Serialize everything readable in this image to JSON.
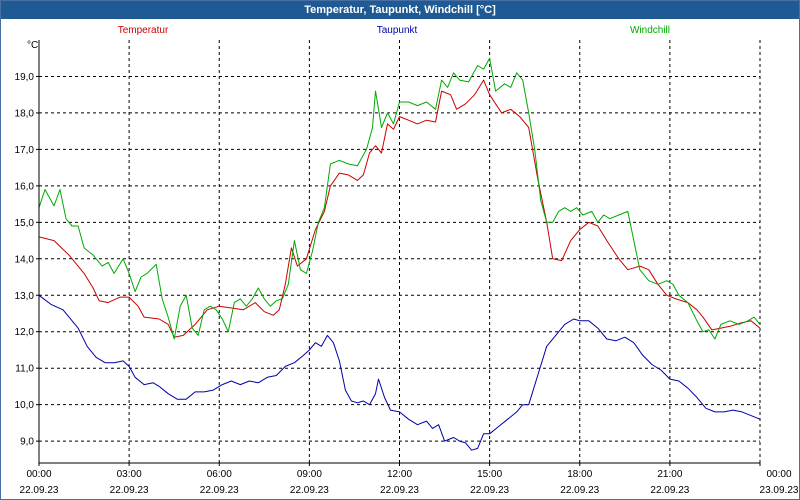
{
  "window": {
    "title": "Temperatur, Taupunkt, Windchill [°C]"
  },
  "chart_data": {
    "type": "line",
    "title": "Temperatur, Taupunkt, Windchill [°C]",
    "ylabel": "°C",
    "xlabel": "",
    "ylim": [
      8.4,
      20.0
    ],
    "xlim": [
      0,
      24
    ],
    "grid": true,
    "legend_position": "top",
    "x_ticks": [
      {
        "x": 0,
        "time": "00:00",
        "date": "22.09.23"
      },
      {
        "x": 3,
        "time": "03:00",
        "date": "22.09.23"
      },
      {
        "x": 6,
        "time": "06:00",
        "date": "22.09.23"
      },
      {
        "x": 9,
        "time": "09:00",
        "date": "22.09.23"
      },
      {
        "x": 12,
        "time": "12:00",
        "date": "22.09.23"
      },
      {
        "x": 15,
        "time": "15:00",
        "date": "22.09.23"
      },
      {
        "x": 18,
        "time": "18:00",
        "date": "22.09.23"
      },
      {
        "x": 21,
        "time": "21:00",
        "date": "22.09.23"
      },
      {
        "x": 24,
        "time": "00:00",
        "date": "23.09.23"
      }
    ],
    "y_ticks": [
      9.0,
      10.0,
      11.0,
      12.0,
      13.0,
      14.0,
      15.0,
      16.0,
      17.0,
      18.0,
      19.0
    ],
    "y_tick_labels": [
      "9,0",
      "10,0",
      "11,0",
      "12,0",
      "13,0",
      "14,0",
      "15,0",
      "16,0",
      "17,0",
      "18,0",
      "19,0"
    ],
    "series": [
      {
        "name": "Temperatur",
        "color": "#cc0000",
        "points": [
          [
            0,
            14.6
          ],
          [
            0.5,
            14.5
          ],
          [
            1,
            14.1
          ],
          [
            1.5,
            13.6
          ],
          [
            1.8,
            13.2
          ],
          [
            2,
            12.85
          ],
          [
            2.3,
            12.8
          ],
          [
            2.7,
            12.95
          ],
          [
            3,
            12.95
          ],
          [
            3.3,
            12.7
          ],
          [
            3.5,
            12.4
          ],
          [
            4,
            12.35
          ],
          [
            4.3,
            12.2
          ],
          [
            4.5,
            11.85
          ],
          [
            4.8,
            11.9
          ],
          [
            5.2,
            12.2
          ],
          [
            5.6,
            12.6
          ],
          [
            6,
            12.7
          ],
          [
            6.4,
            12.65
          ],
          [
            6.8,
            12.6
          ],
          [
            7.2,
            12.8
          ],
          [
            7.5,
            12.55
          ],
          [
            7.8,
            12.45
          ],
          [
            8,
            12.6
          ],
          [
            8.2,
            13.3
          ],
          [
            8.4,
            14.3
          ],
          [
            8.6,
            13.8
          ],
          [
            8.9,
            14.0
          ],
          [
            9.2,
            14.8
          ],
          [
            9.5,
            15.3
          ],
          [
            9.7,
            16.0
          ],
          [
            10,
            16.35
          ],
          [
            10.3,
            16.3
          ],
          [
            10.6,
            16.15
          ],
          [
            10.8,
            16.3
          ],
          [
            11,
            16.9
          ],
          [
            11.2,
            17.1
          ],
          [
            11.4,
            16.9
          ],
          [
            11.6,
            17.7
          ],
          [
            11.8,
            17.55
          ],
          [
            12,
            17.9
          ],
          [
            12.3,
            17.8
          ],
          [
            12.6,
            17.7
          ],
          [
            12.9,
            17.8
          ],
          [
            13.2,
            17.75
          ],
          [
            13.4,
            18.6
          ],
          [
            13.7,
            18.5
          ],
          [
            13.9,
            18.1
          ],
          [
            14.2,
            18.25
          ],
          [
            14.5,
            18.5
          ],
          [
            14.8,
            18.9
          ],
          [
            15,
            18.5
          ],
          [
            15.2,
            18.25
          ],
          [
            15.4,
            18.0
          ],
          [
            15.7,
            18.1
          ],
          [
            16,
            17.9
          ],
          [
            16.3,
            17.6
          ],
          [
            16.6,
            16.2
          ],
          [
            16.9,
            15.0
          ],
          [
            17.1,
            14.0
          ],
          [
            17.4,
            13.95
          ],
          [
            17.7,
            14.5
          ],
          [
            18,
            14.8
          ],
          [
            18.3,
            15.0
          ],
          [
            18.6,
            14.9
          ],
          [
            18.9,
            14.5
          ],
          [
            19.3,
            14.0
          ],
          [
            19.6,
            13.7
          ],
          [
            20,
            13.8
          ],
          [
            20.3,
            13.7
          ],
          [
            20.6,
            13.3
          ],
          [
            20.9,
            13.0
          ],
          [
            21.2,
            12.9
          ],
          [
            21.6,
            12.8
          ],
          [
            21.9,
            12.6
          ],
          [
            22.1,
            12.4
          ],
          [
            22.4,
            12.05
          ],
          [
            22.7,
            12.1
          ],
          [
            23,
            12.15
          ],
          [
            23.4,
            12.25
          ],
          [
            23.7,
            12.3
          ],
          [
            24,
            12.1
          ]
        ]
      },
      {
        "name": "Taupunkt",
        "color": "#0000aa",
        "points": [
          [
            0,
            13.0
          ],
          [
            0.4,
            12.75
          ],
          [
            0.8,
            12.6
          ],
          [
            1,
            12.4
          ],
          [
            1.3,
            12.1
          ],
          [
            1.6,
            11.6
          ],
          [
            1.9,
            11.3
          ],
          [
            2.2,
            11.15
          ],
          [
            2.5,
            11.15
          ],
          [
            2.8,
            11.2
          ],
          [
            3,
            11.05
          ],
          [
            3.2,
            10.75
          ],
          [
            3.5,
            10.55
          ],
          [
            3.8,
            10.6
          ],
          [
            4,
            10.5
          ],
          [
            4.3,
            10.3
          ],
          [
            4.6,
            10.15
          ],
          [
            4.9,
            10.15
          ],
          [
            5.2,
            10.35
          ],
          [
            5.5,
            10.35
          ],
          [
            5.8,
            10.4
          ],
          [
            6.1,
            10.55
          ],
          [
            6.4,
            10.65
          ],
          [
            6.7,
            10.55
          ],
          [
            7,
            10.65
          ],
          [
            7.3,
            10.6
          ],
          [
            7.6,
            10.75
          ],
          [
            7.9,
            10.8
          ],
          [
            8.2,
            11.05
          ],
          [
            8.5,
            11.15
          ],
          [
            8.8,
            11.35
          ],
          [
            9,
            11.5
          ],
          [
            9.2,
            11.7
          ],
          [
            9.4,
            11.6
          ],
          [
            9.6,
            11.9
          ],
          [
            9.8,
            11.7
          ],
          [
            10,
            11.2
          ],
          [
            10.2,
            10.4
          ],
          [
            10.4,
            10.1
          ],
          [
            10.6,
            10.05
          ],
          [
            10.8,
            10.1
          ],
          [
            11,
            10.0
          ],
          [
            11.2,
            10.3
          ],
          [
            11.3,
            10.7
          ],
          [
            11.5,
            10.2
          ],
          [
            11.7,
            9.85
          ],
          [
            12,
            9.8
          ],
          [
            12.3,
            9.6
          ],
          [
            12.6,
            9.45
          ],
          [
            12.9,
            9.55
          ],
          [
            13.1,
            9.35
          ],
          [
            13.3,
            9.45
          ],
          [
            13.5,
            9.0
          ],
          [
            13.8,
            9.1
          ],
          [
            14,
            9.0
          ],
          [
            14.2,
            8.95
          ],
          [
            14.4,
            8.75
          ],
          [
            14.6,
            8.8
          ],
          [
            14.8,
            9.2
          ],
          [
            15,
            9.2
          ],
          [
            15.3,
            9.4
          ],
          [
            15.6,
            9.6
          ],
          [
            15.9,
            9.8
          ],
          [
            16.1,
            10.0
          ],
          [
            16.3,
            10.0
          ],
          [
            16.6,
            10.8
          ],
          [
            16.9,
            11.6
          ],
          [
            17.2,
            11.9
          ],
          [
            17.5,
            12.2
          ],
          [
            17.8,
            12.35
          ],
          [
            18,
            12.3
          ],
          [
            18.3,
            12.3
          ],
          [
            18.6,
            12.1
          ],
          [
            18.9,
            11.8
          ],
          [
            19.2,
            11.75
          ],
          [
            19.5,
            11.85
          ],
          [
            19.8,
            11.7
          ],
          [
            20.1,
            11.35
          ],
          [
            20.4,
            11.1
          ],
          [
            20.7,
            10.95
          ],
          [
            21,
            10.7
          ],
          [
            21.3,
            10.65
          ],
          [
            21.6,
            10.45
          ],
          [
            21.9,
            10.2
          ],
          [
            22.2,
            9.9
          ],
          [
            22.5,
            9.8
          ],
          [
            22.8,
            9.8
          ],
          [
            23.1,
            9.85
          ],
          [
            23.4,
            9.8
          ],
          [
            23.7,
            9.7
          ],
          [
            24,
            9.6
          ]
        ]
      },
      {
        "name": "Windchill",
        "color": "#00aa00",
        "points": [
          [
            0,
            15.4
          ],
          [
            0.2,
            15.9
          ],
          [
            0.5,
            15.45
          ],
          [
            0.7,
            15.9
          ],
          [
            0.9,
            15.1
          ],
          [
            1.1,
            14.9
          ],
          [
            1.3,
            14.9
          ],
          [
            1.5,
            14.3
          ],
          [
            1.8,
            14.1
          ],
          [
            2.1,
            13.8
          ],
          [
            2.3,
            13.9
          ],
          [
            2.5,
            13.6
          ],
          [
            2.8,
            14.0
          ],
          [
            3,
            13.6
          ],
          [
            3.2,
            13.1
          ],
          [
            3.4,
            13.5
          ],
          [
            3.6,
            13.6
          ],
          [
            3.9,
            13.85
          ],
          [
            4.1,
            12.9
          ],
          [
            4.3,
            12.4
          ],
          [
            4.5,
            11.8
          ],
          [
            4.7,
            12.7
          ],
          [
            4.9,
            13.0
          ],
          [
            5.1,
            12.1
          ],
          [
            5.3,
            11.9
          ],
          [
            5.5,
            12.6
          ],
          [
            5.7,
            12.7
          ],
          [
            5.9,
            12.6
          ],
          [
            6.1,
            12.35
          ],
          [
            6.3,
            12.0
          ],
          [
            6.5,
            12.8
          ],
          [
            6.7,
            12.9
          ],
          [
            6.9,
            12.7
          ],
          [
            7.1,
            12.9
          ],
          [
            7.3,
            13.2
          ],
          [
            7.5,
            12.9
          ],
          [
            7.7,
            12.7
          ],
          [
            7.9,
            12.85
          ],
          [
            8.1,
            12.9
          ],
          [
            8.3,
            13.3
          ],
          [
            8.5,
            14.5
          ],
          [
            8.7,
            13.7
          ],
          [
            8.9,
            13.6
          ],
          [
            9.1,
            14.2
          ],
          [
            9.3,
            15.0
          ],
          [
            9.5,
            15.4
          ],
          [
            9.7,
            16.6
          ],
          [
            10,
            16.7
          ],
          [
            10.3,
            16.6
          ],
          [
            10.6,
            16.55
          ],
          [
            10.9,
            17.0
          ],
          [
            11.1,
            17.6
          ],
          [
            11.2,
            18.6
          ],
          [
            11.4,
            17.6
          ],
          [
            11.6,
            18.0
          ],
          [
            11.8,
            17.7
          ],
          [
            12,
            18.3
          ],
          [
            12.3,
            18.3
          ],
          [
            12.6,
            18.2
          ],
          [
            12.9,
            18.3
          ],
          [
            13.2,
            18.1
          ],
          [
            13.4,
            18.9
          ],
          [
            13.6,
            18.7
          ],
          [
            13.8,
            19.1
          ],
          [
            14,
            18.9
          ],
          [
            14.3,
            18.85
          ],
          [
            14.6,
            19.3
          ],
          [
            14.8,
            19.2
          ],
          [
            15,
            19.5
          ],
          [
            15.2,
            18.6
          ],
          [
            15.5,
            18.8
          ],
          [
            15.7,
            18.7
          ],
          [
            15.9,
            19.1
          ],
          [
            16.1,
            18.9
          ],
          [
            16.3,
            18.0
          ],
          [
            16.5,
            17.0
          ],
          [
            16.7,
            15.6
          ],
          [
            16.9,
            15.0
          ],
          [
            17.1,
            15.0
          ],
          [
            17.3,
            15.3
          ],
          [
            17.5,
            15.4
          ],
          [
            17.7,
            15.3
          ],
          [
            17.9,
            15.4
          ],
          [
            18.1,
            15.2
          ],
          [
            18.4,
            15.3
          ],
          [
            18.6,
            15.0
          ],
          [
            18.8,
            15.2
          ],
          [
            19,
            15.1
          ],
          [
            19.3,
            15.2
          ],
          [
            19.6,
            15.3
          ],
          [
            19.8,
            14.5
          ],
          [
            20,
            13.7
          ],
          [
            20.3,
            13.4
          ],
          [
            20.6,
            13.3
          ],
          [
            20.9,
            13.4
          ],
          [
            21.1,
            13.3
          ],
          [
            21.3,
            13.0
          ],
          [
            21.6,
            12.8
          ],
          [
            21.9,
            12.3
          ],
          [
            22.1,
            12.0
          ],
          [
            22.3,
            12.05
          ],
          [
            22.5,
            11.8
          ],
          [
            22.7,
            12.2
          ],
          [
            23,
            12.3
          ],
          [
            23.3,
            12.2
          ],
          [
            23.6,
            12.3
          ],
          [
            23.8,
            12.4
          ],
          [
            24,
            12.2
          ]
        ]
      }
    ]
  }
}
